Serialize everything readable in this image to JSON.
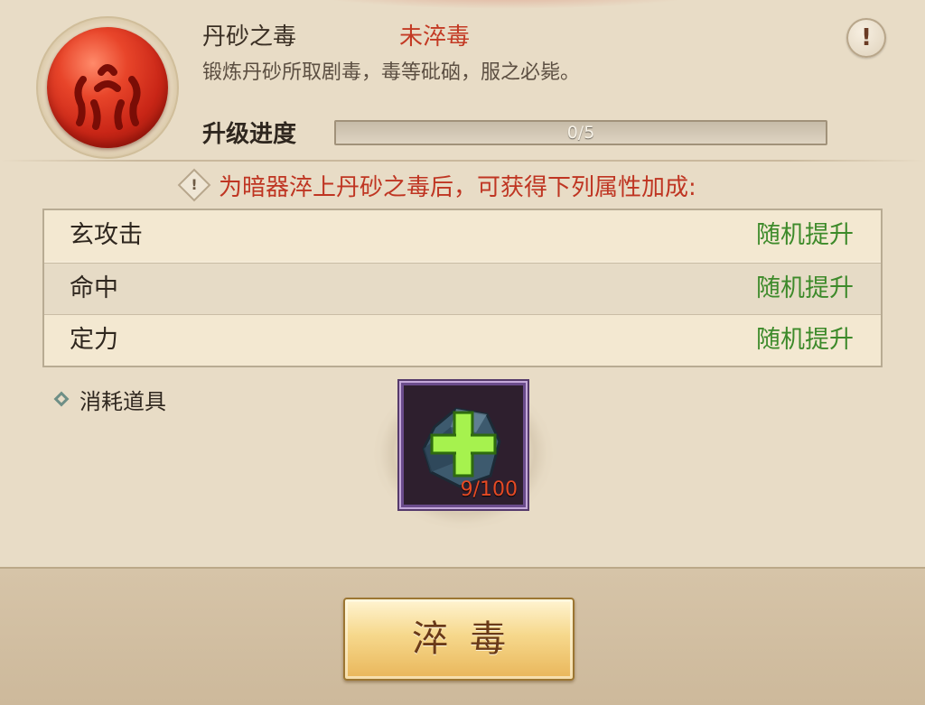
{
  "poison": {
    "name": "丹砂之毒",
    "status": "未淬毒",
    "description": "锻炼丹砂所取剧毒，毒等砒硇，服之必毙。",
    "info_label": "!"
  },
  "progress": {
    "label": "升级进度",
    "text": "0/5",
    "current": 0,
    "max": 5
  },
  "notice": {
    "icon": "!",
    "text": "为暗器淬上丹砂之毒后，可获得下列属性加成:"
  },
  "attributes": [
    {
      "name": "玄攻击",
      "value": "随机提升"
    },
    {
      "name": "命中",
      "value": "随机提升"
    },
    {
      "name": "定力",
      "value": "随机提升"
    }
  ],
  "consumables": {
    "label": "消耗道具",
    "item_count": "9/100",
    "item_icon": "stone-icon"
  },
  "action": {
    "label": "淬毒"
  },
  "colors": {
    "status_red": "#c33a24",
    "value_green": "#3d8a2a",
    "slot_border": "#6b4c8c"
  }
}
